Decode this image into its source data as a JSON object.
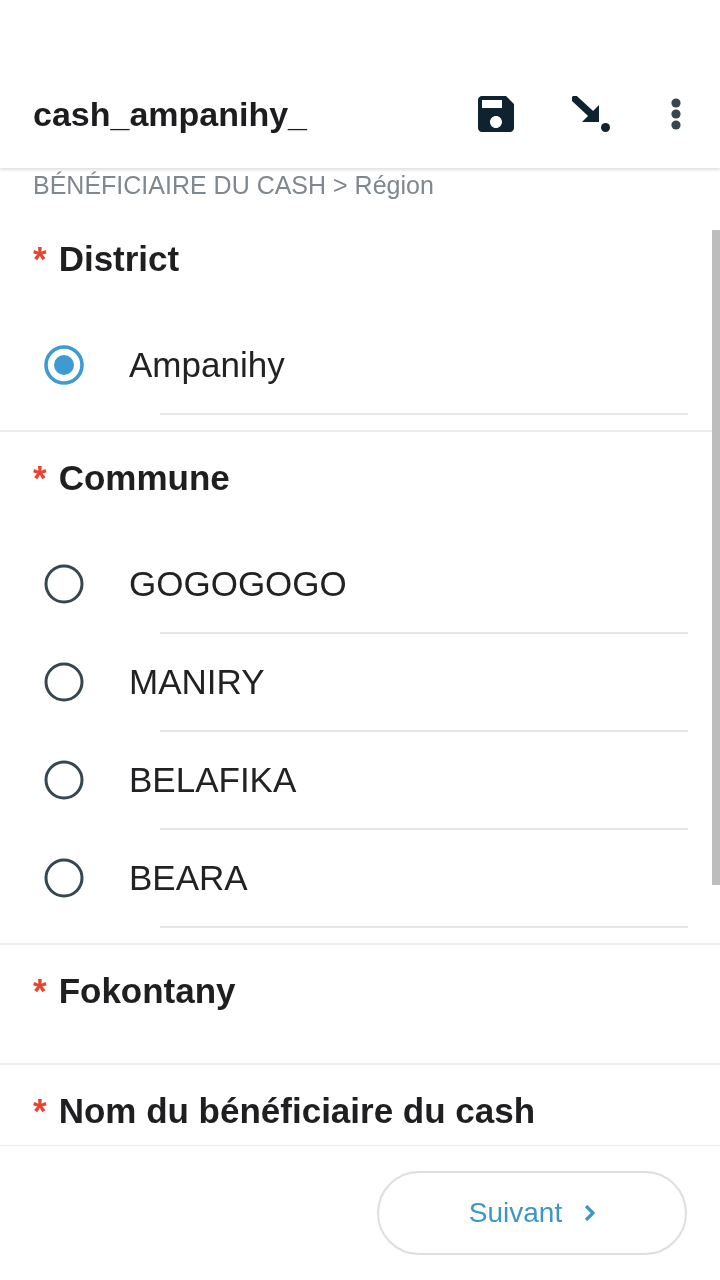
{
  "app_bar": {
    "title": "cash_ampanihy_",
    "actions": [
      {
        "kind": "save"
      },
      {
        "kind": "arrow"
      },
      {
        "kind": "more"
      }
    ]
  },
  "breadcrumb": "BÉNÉFICIAIRE DU CASH > Région",
  "questions": [
    {
      "required_mark": "*",
      "label": "District",
      "options": [
        {
          "label": "Ampanihy",
          "selected": true
        }
      ]
    },
    {
      "required_mark": "*",
      "label": "Commune",
      "options": [
        {
          "label": "GOGOGOGO",
          "selected": false
        },
        {
          "label": "MANIRY",
          "selected": false
        },
        {
          "label": "BELAFIKA",
          "selected": false
        },
        {
          "label": "BEARA",
          "selected": false
        }
      ]
    },
    {
      "required_mark": "*",
      "label": "Fokontany"
    },
    {
      "required_mark": "*",
      "label": "Nom du bénéficiaire du cash"
    }
  ],
  "next_button": {
    "label": "Suivant"
  }
}
